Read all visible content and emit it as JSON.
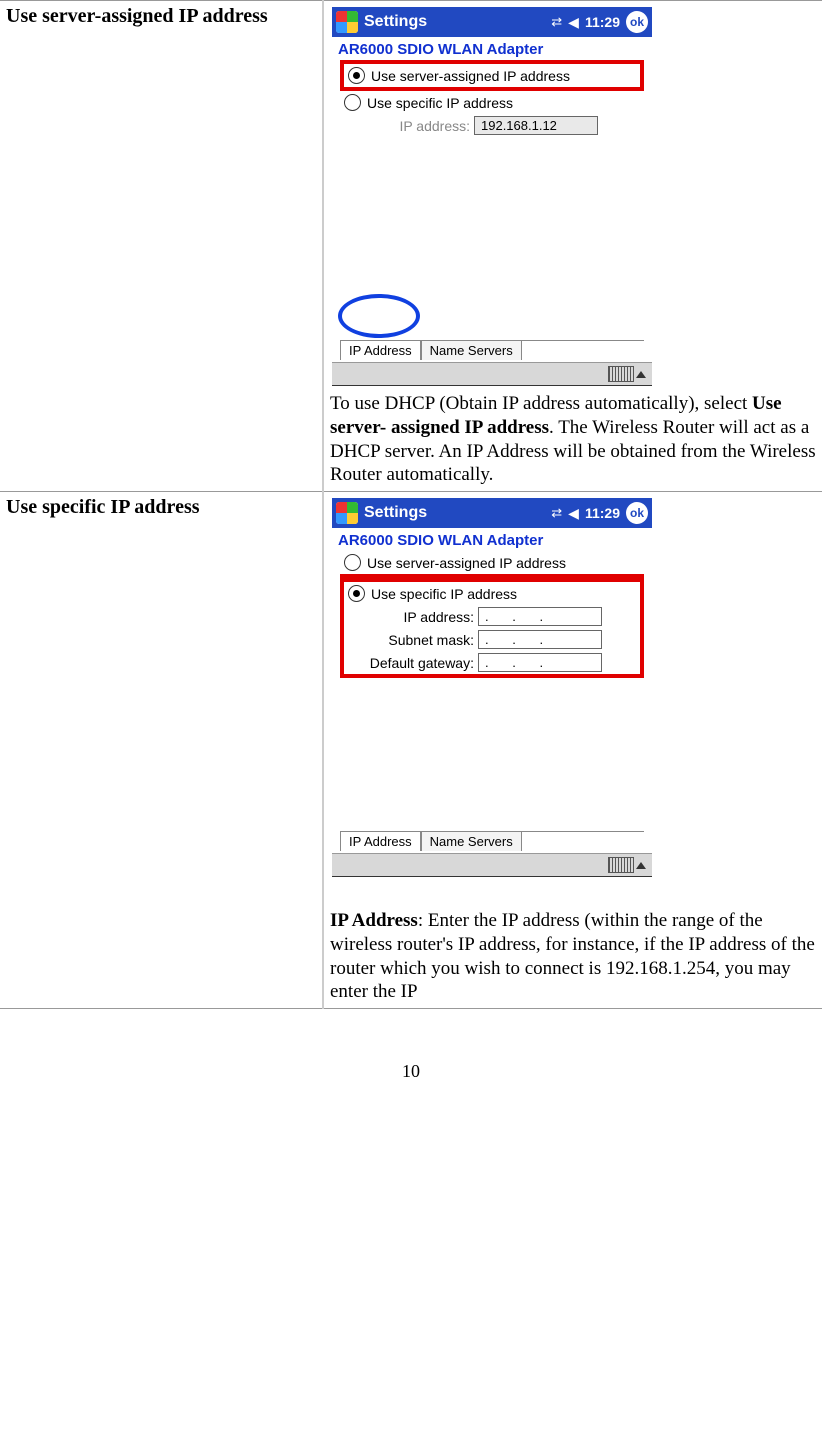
{
  "page_number": "10",
  "rows": [
    {
      "title": "Use server-assigned IP address",
      "desc_pre": "To use DHCP (Obtain IP address automatically), select ",
      "desc_bold": "Use server- assigned IP address",
      "desc_post": ". The Wireless Router will act as a DHCP server. An IP Address will be obtained from the Wireless Router automatically."
    },
    {
      "title": "Use specific IP address",
      "desc_bold": "IP Address",
      "desc_post": ": Enter the IP address (within the range of the wireless router's IP address, for instance, if the IP address of the router which you wish to connect is 192.168.1.254, you may enter the IP"
    }
  ],
  "screenshot1": {
    "titlebar": "Settings",
    "time": "11:29",
    "ok": "ok",
    "adapter": "AR6000 SDIO WLAN Adapter",
    "radio_server": "Use server-assigned IP address",
    "radio_specific": "Use specific IP address",
    "ip_label": "IP address:",
    "ip_value": "192.168.1.12",
    "tab_ip": "IP Address",
    "tab_ns": "Name Servers"
  },
  "screenshot2": {
    "titlebar": "Settings",
    "time": "11:29",
    "ok": "ok",
    "adapter": "AR6000 SDIO WLAN Adapter",
    "radio_server": "Use server-assigned IP address",
    "radio_specific": "Use specific IP address",
    "ip_label": "IP address:",
    "subnet_label": "Subnet mask:",
    "gateway_label": "Default gateway:",
    "empty_ip": ".   .   .",
    "tab_ip": "IP Address",
    "tab_ns": "Name Servers"
  }
}
